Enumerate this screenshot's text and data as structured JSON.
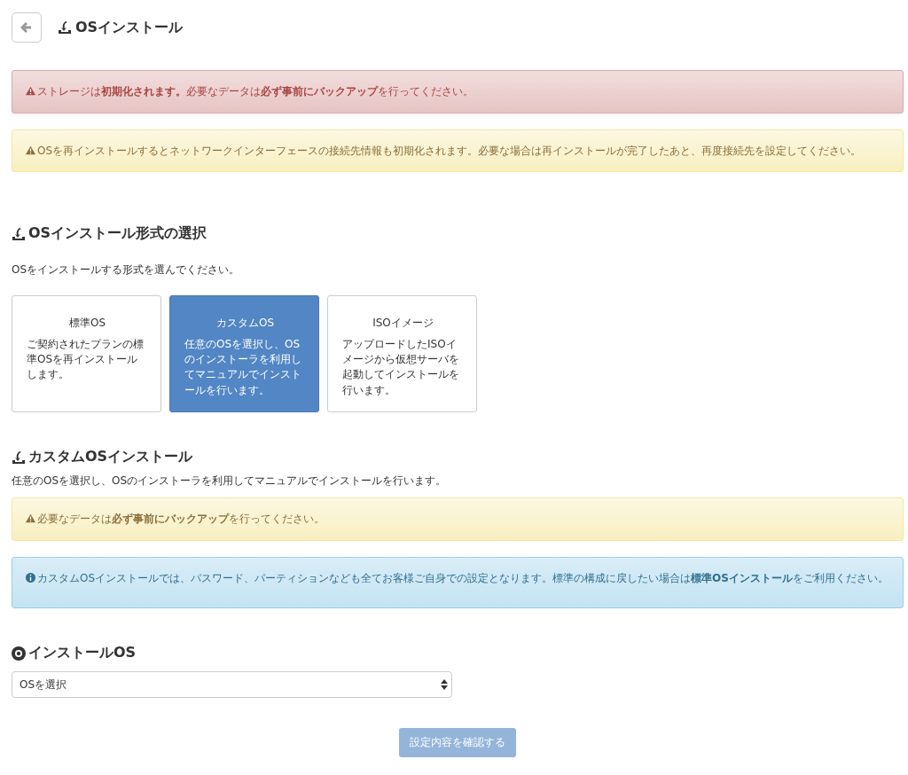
{
  "header": {
    "title": "OSインストール"
  },
  "alerts": [
    {
      "kind": "danger",
      "text": "ストレージは**初期化されます。**必要なデータは**必ず事前にバックアップ**を行ってください。"
    },
    {
      "kind": "warning",
      "text": "OSを再インストールするとネットワークインターフェースの接続先情報も初期化されます。必要な場合は再インストールが完了したあと、再度接続先を設定してください。"
    }
  ],
  "format_section": {
    "title": "OSインストール形式の選択",
    "description": "OSをインストールする形式を選んでください。",
    "options": [
      {
        "title": "標準OS",
        "description": "ご契約されたプランの標準OSを再インストールします。",
        "selected": false
      },
      {
        "title": "カスタムOS",
        "description": "任意のOSを選択し、OSのインストーラを利用してマニュアルでインストールを行います。",
        "selected": true
      },
      {
        "title": "ISOイメージ",
        "description": "アップロードしたISOイメージから仮想サーバを起動してインストールを行います。",
        "selected": false
      }
    ]
  },
  "custom_section": {
    "title": "カスタムOSインストール",
    "description": "任意のOSを選択し、OSのインストーラを利用してマニュアルでインストールを行います。",
    "alerts": [
      {
        "kind": "warning",
        "text": "必要なデータは**必ず事前にバックアップ**を行ってください。"
      },
      {
        "kind": "info",
        "text": "カスタムOSインストールでは、パスワード、パーティションなども全てお客様ご自身での設定となります。標準の構成に戻したい場合は**標準OSインストール**をご利用ください。"
      }
    ]
  },
  "os_section": {
    "title": "インストールOS",
    "select": {
      "value": "OSを選択"
    }
  },
  "submit": {
    "label": "設定内容を確認する",
    "disabled": true
  }
}
